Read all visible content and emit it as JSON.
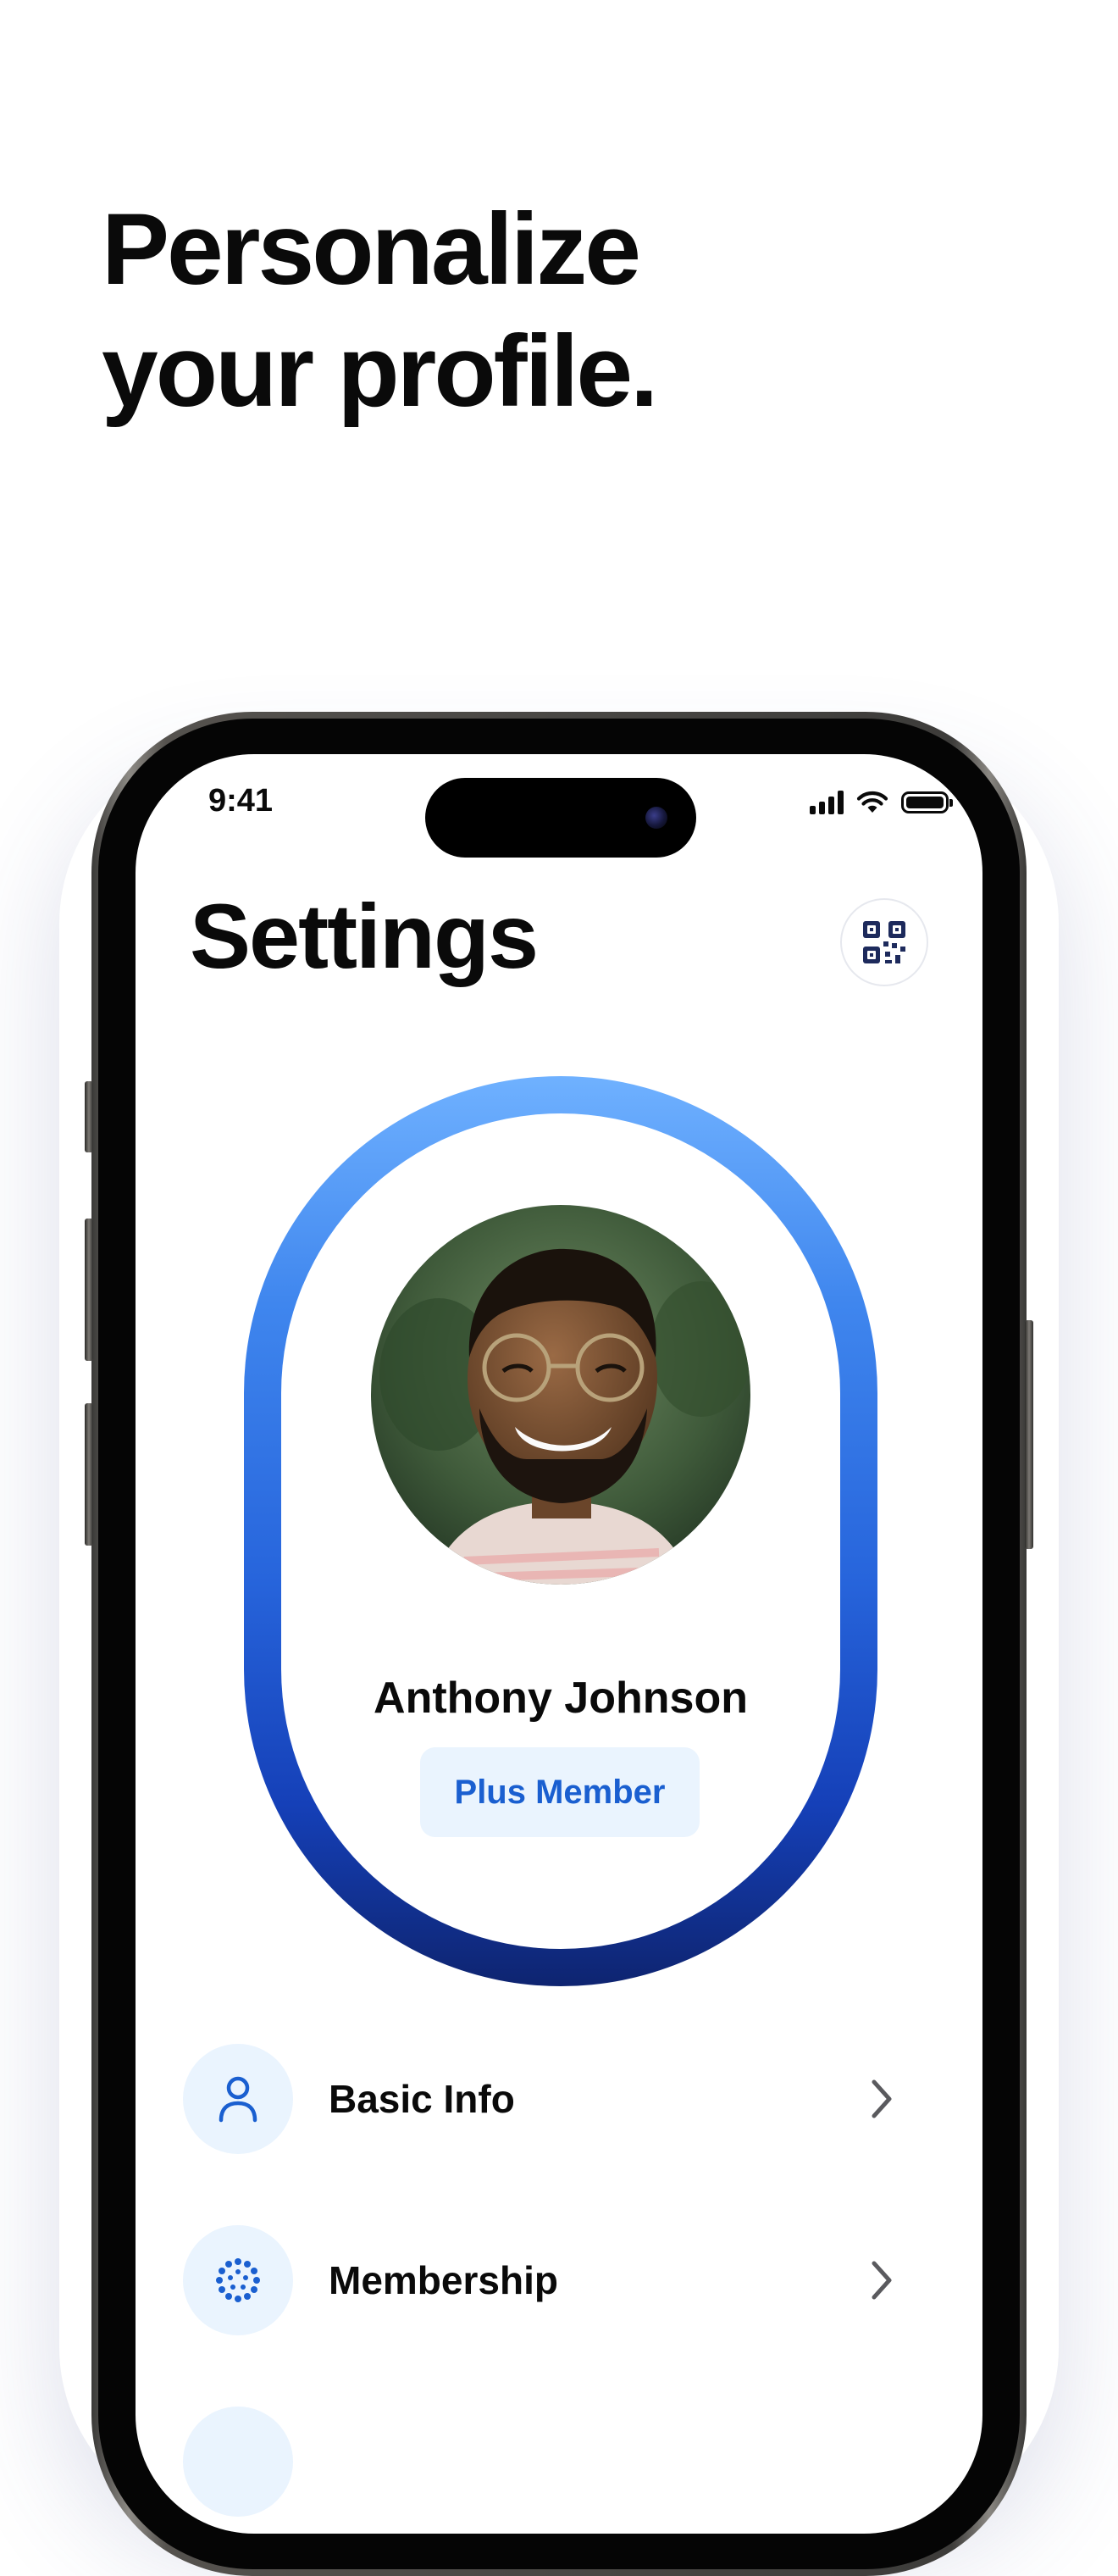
{
  "headline": {
    "line1": "Personalize",
    "line2": "your profile."
  },
  "status_bar": {
    "time": "9:41"
  },
  "screen": {
    "title": "Settings",
    "qr_icon": "qr-code-icon"
  },
  "profile": {
    "name": "Anthony Johnson",
    "badge": "Plus Member"
  },
  "menu": [
    {
      "label": "Basic Info",
      "icon": "person-icon"
    },
    {
      "label": "Membership",
      "icon": "membership-dots-icon"
    }
  ],
  "colors": {
    "accent": "#1a5fd0",
    "ring_top": "#6fb1ff",
    "ring_bottom": "#0e2470",
    "icon_bg": "#eaf4fe",
    "text": "#0a0a0a"
  }
}
